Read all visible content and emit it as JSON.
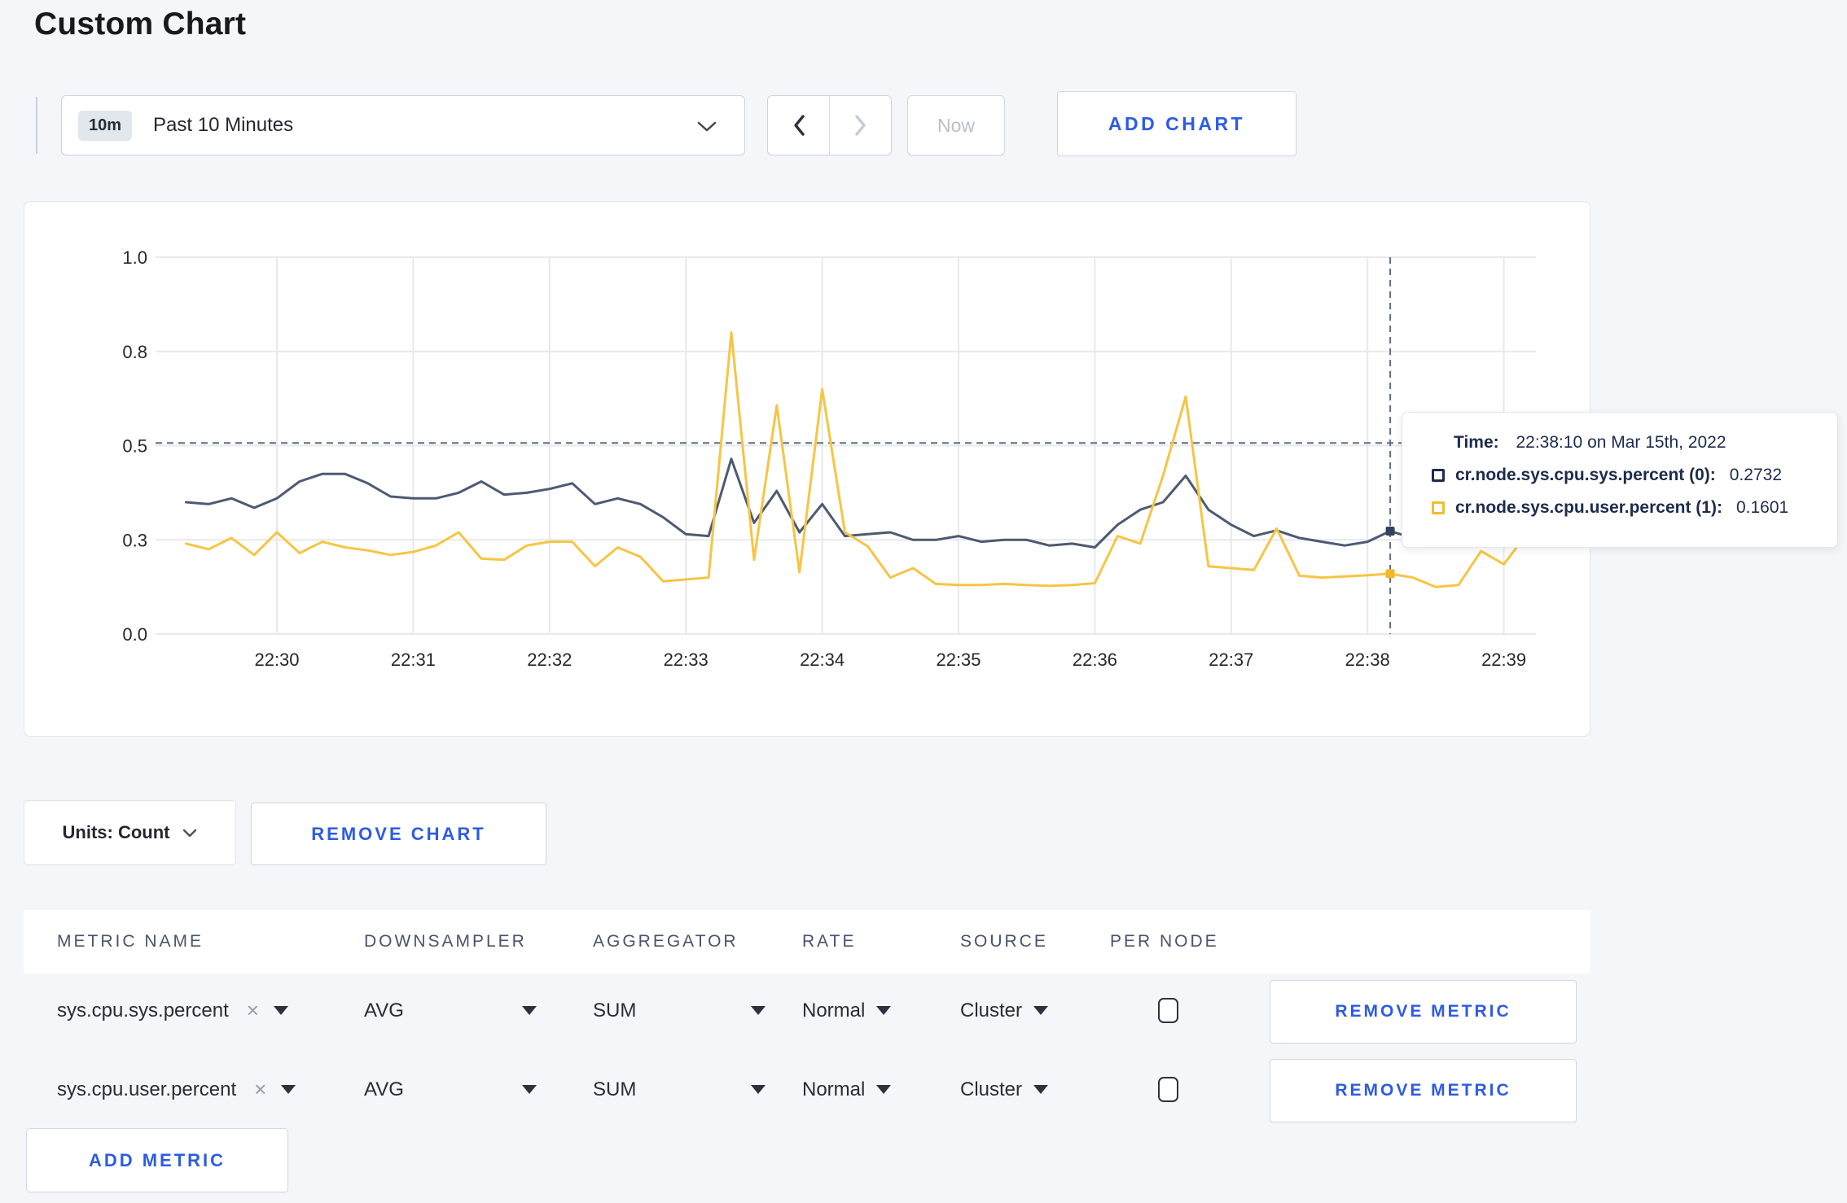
{
  "page": {
    "title": "Custom Chart"
  },
  "toolbar": {
    "time_badge": "10m",
    "time_label": "Past 10 Minutes",
    "now_label": "Now",
    "add_chart_label": "ADD CHART"
  },
  "chart_data": {
    "type": "line",
    "title": "",
    "xlabel": "",
    "ylabel": "",
    "ylim": [
      0,
      1
    ],
    "grid": true,
    "x_tick_labels": [
      "22:30",
      "22:31",
      "22:32",
      "22:33",
      "22:34",
      "22:35",
      "22:36",
      "22:37",
      "22:38",
      "22:39"
    ],
    "y_tick_labels": [
      "0.0",
      "0.3",
      "0.5",
      "0.8",
      "1.0"
    ],
    "y_tick_values": [
      0,
      0.25,
      0.5,
      0.75,
      1.0
    ],
    "x_start": "22:29:20",
    "x_step_seconds": 10,
    "series": [
      {
        "name": "cr.node.sys.cpu.sys.percent",
        "color": "#4d5a72",
        "values": [
          0.35,
          0.345,
          0.36,
          0.335,
          0.36,
          0.405,
          0.425,
          0.425,
          0.4,
          0.365,
          0.36,
          0.36,
          0.375,
          0.405,
          0.37,
          0.375,
          0.385,
          0.4,
          0.345,
          0.36,
          0.345,
          0.31,
          0.265,
          0.26,
          0.465,
          0.295,
          0.38,
          0.27,
          0.345,
          0.26,
          0.265,
          0.27,
          0.25,
          0.25,
          0.26,
          0.245,
          0.25,
          0.25,
          0.235,
          0.24,
          0.23,
          0.29,
          0.33,
          0.35,
          0.42,
          0.33,
          0.29,
          0.26,
          0.275,
          0.255,
          0.245,
          0.235,
          0.245,
          0.2732,
          0.255,
          0.25,
          0.27,
          0.3,
          0.285,
          0.295
        ]
      },
      {
        "name": "cr.node.sys.cpu.user.percent",
        "color": "#f6c544",
        "values": [
          0.24,
          0.225,
          0.255,
          0.21,
          0.27,
          0.215,
          0.245,
          0.23,
          0.222,
          0.21,
          0.218,
          0.235,
          0.27,
          0.2,
          0.197,
          0.235,
          0.245,
          0.245,
          0.18,
          0.23,
          0.205,
          0.14,
          0.145,
          0.15,
          0.8,
          0.197,
          0.607,
          0.164,
          0.65,
          0.27,
          0.233,
          0.15,
          0.175,
          0.133,
          0.13,
          0.13,
          0.133,
          0.13,
          0.128,
          0.13,
          0.135,
          0.26,
          0.24,
          0.42,
          0.63,
          0.18,
          0.175,
          0.17,
          0.28,
          0.155,
          0.15,
          0.153,
          0.156,
          0.1601,
          0.15,
          0.125,
          0.13,
          0.22,
          0.185,
          0.265
        ]
      }
    ],
    "crosshair": {
      "time": "22:38:10",
      "hline_value": 0.507,
      "marker_values": [
        0.2732,
        0.1601
      ],
      "marker_colors": [
        "#35415c",
        "#f0b929"
      ],
      "line_color": "#5d6f83"
    },
    "legend_position": "tooltip"
  },
  "tooltip": {
    "time_label": "Time:",
    "time_value": "22:38:10 on Mar 15th, 2022",
    "rows": [
      {
        "label": "cr.node.sys.cpu.sys.percent (0):",
        "value": "0.2732",
        "swatch_color": "#1c2b4d"
      },
      {
        "label": "cr.node.sys.cpu.user.percent (1):",
        "value": "0.1601",
        "swatch_color": "#f2bd2d"
      }
    ]
  },
  "units_bar": {
    "units_label": "Units: Count",
    "remove_chart_label": "REMOVE CHART"
  },
  "table": {
    "columns": [
      "METRIC NAME",
      "DOWNSAMPLER",
      "AGGREGATOR",
      "RATE",
      "SOURCE",
      "PER NODE"
    ],
    "rows": [
      {
        "metric_name": "sys.cpu.sys.percent",
        "remove_tag": "×",
        "downsampler": "AVG",
        "aggregator": "SUM",
        "rate": "Normal",
        "source": "Cluster",
        "per_node_checked": false,
        "remove_label": "REMOVE METRIC"
      },
      {
        "metric_name": "sys.cpu.user.percent",
        "remove_tag": "×",
        "downsampler": "AVG",
        "aggregator": "SUM",
        "rate": "Normal",
        "source": "Cluster",
        "per_node_checked": false,
        "remove_label": "REMOVE METRIC"
      }
    ],
    "add_metric_label": "ADD METRIC"
  },
  "colors": {
    "accent_blue": "#2e5be5",
    "page_background": "#f4f6f9",
    "panel_border": "#e1e5eb",
    "gridline": "#e7e9ed"
  }
}
